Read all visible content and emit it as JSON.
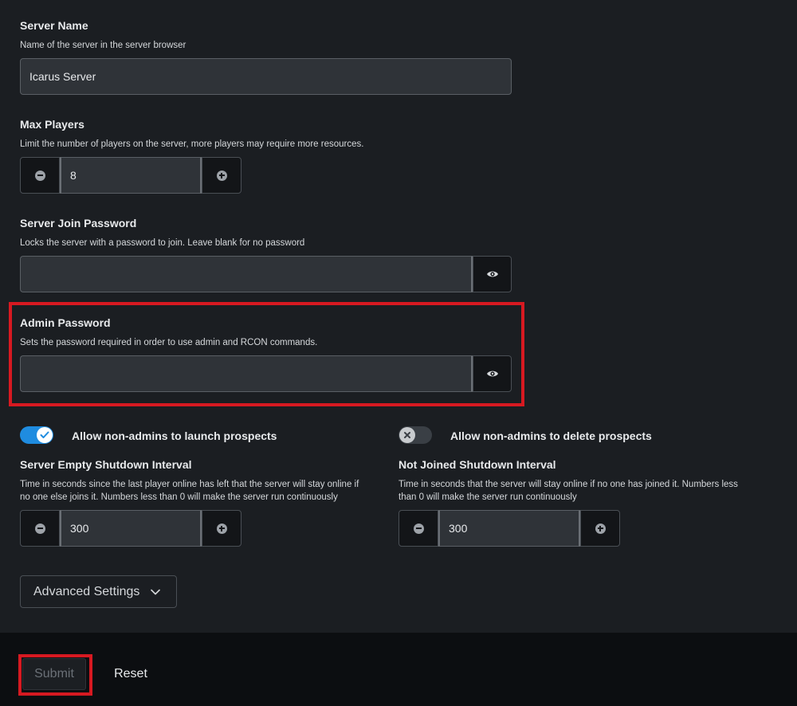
{
  "server_name": {
    "label": "Server Name",
    "description": "Name of the server in the server browser",
    "value": "Icarus Server"
  },
  "max_players": {
    "label": "Max Players",
    "description": "Limit the number of players on the server, more players may require more resources.",
    "value": "8"
  },
  "join_password": {
    "label": "Server Join Password",
    "description": "Locks the server with a password to join. Leave blank for no password",
    "value": ""
  },
  "admin_password": {
    "label": "Admin Password",
    "description": "Sets the password required in order to use admin and RCON commands.",
    "value": ""
  },
  "toggles": {
    "launch": {
      "label": "Allow non-admins to launch prospects",
      "on": true
    },
    "delete": {
      "label": "Allow non-admins to delete prospects",
      "on": false
    }
  },
  "empty_shutdown": {
    "label": "Server Empty Shutdown Interval",
    "description_line1": "Time in seconds since the last player online has left that the server will stay online if",
    "description_line2": "no one else joins it. Numbers less than 0 will make the server run continuously",
    "value": "300"
  },
  "not_joined_shutdown": {
    "label": "Not Joined Shutdown Interval",
    "description_line1": "Time in seconds that the server will stay online if no one has joined it. Numbers less",
    "description_line2": "than 0 will make the server run continuously",
    "value": "300"
  },
  "advanced": {
    "label": "Advanced Settings"
  },
  "footer": {
    "submit_label": "Submit",
    "reset_label": "Reset"
  },
  "colors": {
    "accent": "#1f8ce0",
    "highlight": "#d71921",
    "background": "#1b1e22",
    "footer_bg": "#0c0e11"
  },
  "icons": {
    "minus": "minus-circle-icon",
    "plus": "plus-circle-icon",
    "reveal": "eye-icon",
    "check": "check-icon",
    "close": "close-icon",
    "chevron": "chevron-down-icon"
  }
}
